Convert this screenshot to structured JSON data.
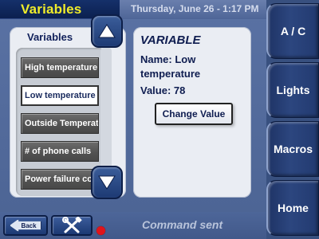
{
  "header": {
    "title": "Variables",
    "datetime": "Thursday, June 26 - 1:17 PM"
  },
  "sidenav": {
    "items": [
      {
        "label": "A / C"
      },
      {
        "label": "Lights"
      },
      {
        "label": "Macros"
      },
      {
        "label": "Home"
      }
    ]
  },
  "variables_panel": {
    "title": "Variables",
    "items": [
      {
        "label": "High temperature",
        "selected": false
      },
      {
        "label": "Low temperature",
        "selected": true
      },
      {
        "label": "Outside Temperature",
        "selected": false
      },
      {
        "label": "# of phone calls",
        "selected": false
      },
      {
        "label": "Power failure count",
        "selected": false
      }
    ]
  },
  "detail": {
    "heading": "VARIABLE",
    "name_line": "Name: Low temperature",
    "value_line": "Value: 78",
    "change_button": "Change Value"
  },
  "footer": {
    "back_label": "Back",
    "status_text": "Command sent",
    "status_indicator_color": "#e0141a"
  },
  "colors": {
    "title_accent": "#f0ec2a",
    "nav_background": "#2c467f",
    "panel_background": "#eaedf3"
  }
}
